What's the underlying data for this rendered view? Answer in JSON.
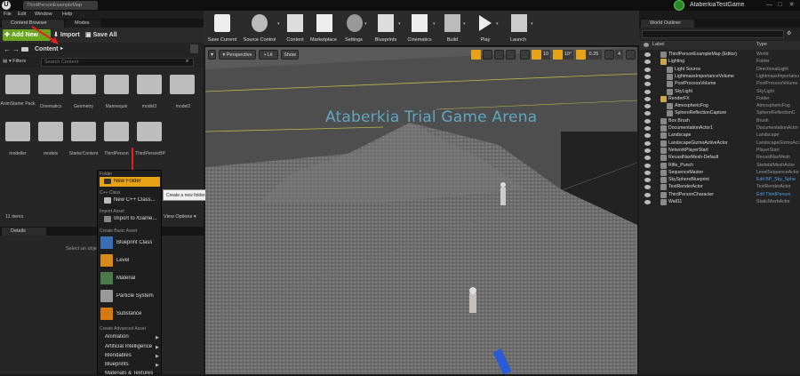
{
  "window": {
    "doc_tab": "ThirdPersonExampleMap",
    "project_name": "AtaberkiaTestGame",
    "min": "—",
    "max": "□",
    "close": "✕"
  },
  "menubar": [
    "File",
    "Edit",
    "Window",
    "Help"
  ],
  "content_browser": {
    "tab": "Content Browser",
    "modes_tab": "Modes",
    "add_new": "Add New",
    "import": "Import",
    "save_all": "Save All",
    "path": "Content",
    "filters": "Filters",
    "search_placeholder": "Search Content",
    "folders": [
      "AnimStarter Pack",
      "Cinematics",
      "Geometry",
      "Mannequin",
      "model3",
      "model2",
      "modeller",
      "models",
      "StarterContent",
      "ThirdPerson",
      "ThirdPersonBP"
    ],
    "items_count": "11 items",
    "view_options": "View Options"
  },
  "details": {
    "tab": "Details",
    "hint": "Select an obje"
  },
  "add_new_menu": {
    "folder_header": "Folder",
    "new_folder": "New Folder",
    "cpp_header": "C++ Class",
    "new_cpp": "New C++ Class...",
    "import_header": "Import Asset",
    "import_to": "Import to /Game...",
    "basic_header": "Create Basic Asset",
    "basic": [
      "Blueprint Class",
      "Level",
      "Material",
      "Particle System",
      "Substance"
    ],
    "advanced_header": "Create Advanced Asset",
    "advanced": [
      "Animation",
      "Artificial Intelligence",
      "Blendables",
      "Blueprints",
      "Materials & Textures"
    ],
    "tooltip": "Create a new folder in /Game"
  },
  "toolbar": {
    "buttons": [
      "Save Current",
      "Source Control",
      "Content",
      "Marketplace",
      "Settings",
      "Blueprints",
      "Cinematics",
      "Build",
      "Play",
      "Launch"
    ]
  },
  "viewport": {
    "perspective": "Perspective",
    "lit": "Lit",
    "show": "Show",
    "grid_snap": "10",
    "rot_snap": "10°",
    "scale_snap": "0.25",
    "cam_speed": "4",
    "arena_text": "Ataberkia Trial Game Arena"
  },
  "outliner": {
    "tab": "World Outliner",
    "col_label": "Label",
    "col_type": "Type",
    "rows": [
      {
        "label": "ThirdPersonExampleMap (Editor)",
        "type": "World"
      },
      {
        "label": "Lighting",
        "type": "Folder"
      },
      {
        "label": "Light Source",
        "type": "DirectionalLight"
      },
      {
        "label": "LightmassImportanceVolume",
        "type": "LightmassImportanceVolu"
      },
      {
        "label": "PostProcessVolume",
        "type": "PostProcessVolume"
      },
      {
        "label": "SkyLight",
        "type": "SkyLight"
      },
      {
        "label": "RenderFX",
        "type": "Folder"
      },
      {
        "label": "AtmosphericFog",
        "type": "AtmosphericFog"
      },
      {
        "label": "SphereReflectionCapture",
        "type": "SphereReflectionC"
      },
      {
        "label": "Box Brush",
        "type": "Brush"
      },
      {
        "label": "DocumentationActor1",
        "type": "DocumentationActor"
      },
      {
        "label": "Landscape",
        "type": "Landscape"
      },
      {
        "label": "LandscapeGizmoActiveActor",
        "type": "LandscapeGizmoActive"
      },
      {
        "label": "NetworkPlayerStart",
        "type": "PlayerStart"
      },
      {
        "label": "RecastNavMesh-Default",
        "type": "RecastNavMesh"
      },
      {
        "label": "Rifle_Punch",
        "type": "SkeletalMeshActor"
      },
      {
        "label": "SequenceMaster",
        "type": "LevelSequenceActor"
      },
      {
        "label": "SkySphereBlueprint",
        "type": "Edit BP_Sky_Sphe"
      },
      {
        "label": "TextRenderActor",
        "type": "TextRenderActor"
      },
      {
        "label": "ThirdPersonCharacter",
        "type": "Edit ThirdPerson"
      },
      {
        "label": "Wall11",
        "type": "StaticMeshActor"
      }
    ]
  },
  "colors": {
    "accent_green": "#6aa421",
    "highlight_orange": "#e6a317",
    "link_blue": "#4f9fe0"
  }
}
